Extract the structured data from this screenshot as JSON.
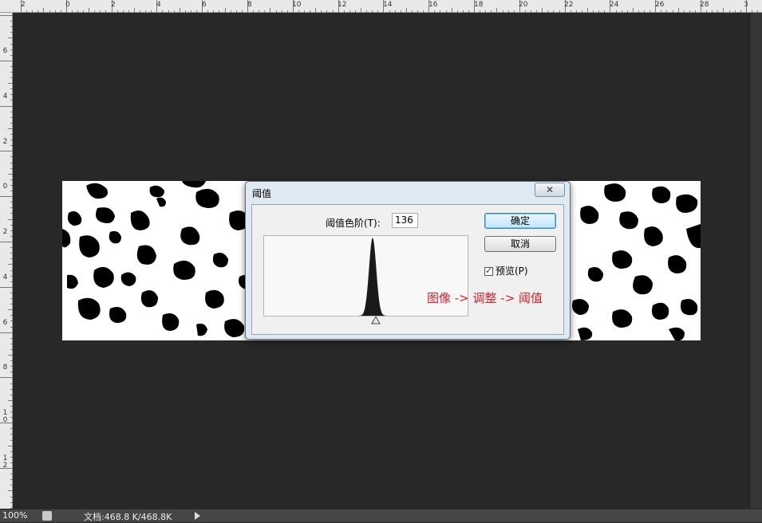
{
  "ruler": {
    "top_labels": [
      "2",
      "0",
      "2",
      "4",
      "6",
      "8",
      "10",
      "12",
      "14",
      "16",
      "18",
      "20",
      "22",
      "24",
      "26",
      "28",
      "3"
    ],
    "left_labels": [
      "6",
      "4",
      "2",
      "0",
      "2",
      "4",
      "6",
      "8",
      "1\n0",
      "1\n2"
    ]
  },
  "dialog": {
    "title": "阈值",
    "close_symbol": "✕",
    "level_label": "阈值色阶(T):",
    "level_value": "136",
    "ok_label": "确定",
    "cancel_label": "取消",
    "preview_label": "预览(P)",
    "preview_checked": true,
    "annotation": "图像 -> 调整 -> 阈值",
    "histogram_peak_level": 136
  },
  "status": {
    "zoom": "100%",
    "doc_info": "文档:468.8 K/468.8K"
  },
  "colors": {
    "workspace": "#282828",
    "annotation": "#c8262c",
    "primary_button": "#bee6fd"
  }
}
